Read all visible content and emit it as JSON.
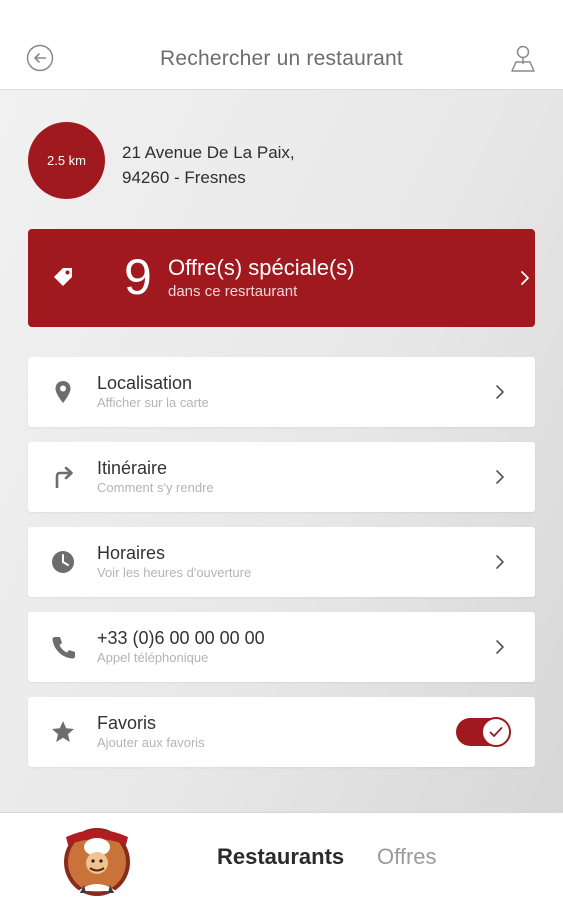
{
  "header": {
    "title": "Rechercher un restaurant"
  },
  "restaurant": {
    "distance": "2.5 km",
    "address_line1": "21 Avenue De La Paix,",
    "address_line2": "94260 - Fresnes"
  },
  "offers": {
    "count": "9",
    "title": "Offre(s) spéciale(s)",
    "subtitle": "dans ce resrtaurant"
  },
  "rows": [
    {
      "label": "Localisation",
      "sub": "Afficher sur la carte",
      "icon": "map-pin-icon"
    },
    {
      "label": "Itinéraire",
      "sub": "Comment s'y rendre",
      "icon": "turn-right-icon"
    },
    {
      "label": "Horaires",
      "sub": "Voir les heures d'ouverture",
      "icon": "clock-icon"
    },
    {
      "label": "+33 (0)6 00 00 00 00",
      "sub": "Appel téléphonique",
      "icon": "phone-icon"
    },
    {
      "label": "Favoris",
      "sub": "Ajouter aux favoris",
      "icon": "star-icon",
      "toggle_on": true
    }
  ],
  "bottom_nav": {
    "tabs": [
      "Restaurants",
      "Offres"
    ],
    "active": "Restaurants"
  },
  "colors": {
    "accent": "#a0191e",
    "background": "#ececec",
    "icon_gray": "#6d6d6d"
  }
}
